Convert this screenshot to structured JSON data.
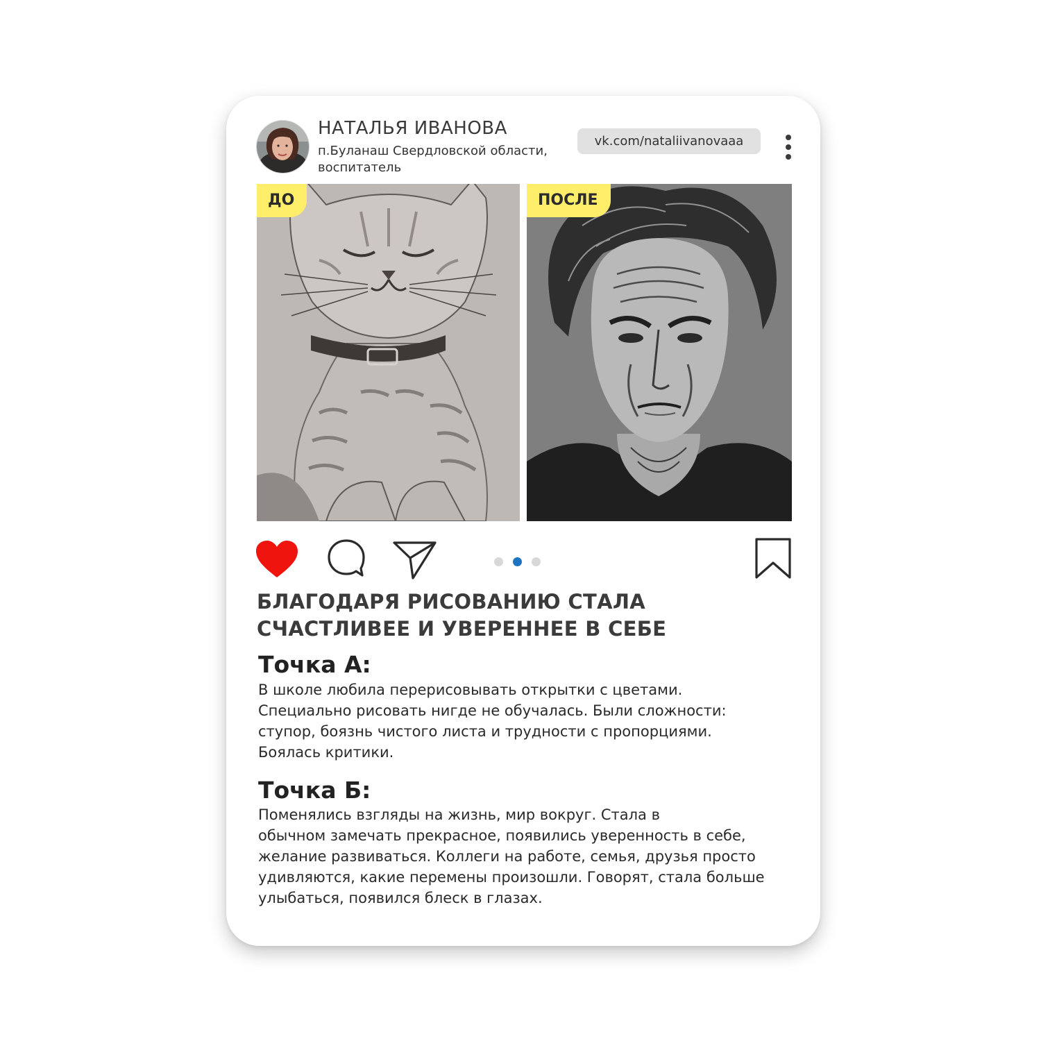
{
  "author": {
    "name": "НАТАЛЬЯ ИВАНОВА",
    "info_lines": [
      "п.Буланаш Свердловской области,",
      "воспитатель"
    ],
    "profile_link": "vk.com/nataliivanovaaa"
  },
  "photos": {
    "before_label": "ДО",
    "after_label": "ПОСЛЕ"
  },
  "actions": {
    "like": {
      "icon": "heart-icon",
      "liked": true,
      "color": "#f0140f"
    },
    "comment": {
      "icon": "comment-icon"
    },
    "share": {
      "icon": "paper-plane-icon"
    },
    "bookmark": {
      "icon": "bookmark-icon"
    },
    "carousel": {
      "total": 3,
      "active_index": 1,
      "active_color": "#1f74c2"
    }
  },
  "post": {
    "headline_lines": [
      "БЛАГОДАРЯ РИСОВАНИЮ СТАЛА",
      "СЧАСТЛИВЕЕ И УВЕРЕННЕЕ В СЕБЕ"
    ],
    "section_a": {
      "title": "Точка А:",
      "lines": [
        "В школе любила перерисовывать открытки с цветами.",
        "Специально рисовать нигде не обучалась. Были сложности:",
        "ступор, боязнь чистого листа и трудности с пропорциями.",
        "Боялась критики."
      ]
    },
    "section_b": {
      "title": "Точка Б:",
      "lines": [
        "Поменялись взгляды на жизнь, мир вокруг. Стала в",
        "обычном замечать прекрасное, появились уверенность в себе,",
        "желание развиваться. Коллеги на работе, семья, друзья просто",
        "удивляются, какие перемены произошли. Говорят, стала больше",
        "улыбаться, появился блеск в глазах."
      ]
    }
  },
  "colors": {
    "tag_yellow": "#ffee6a",
    "link_pill": "#e1e1e1",
    "heart_red": "#f0140f",
    "dot_active": "#1f74c2"
  }
}
